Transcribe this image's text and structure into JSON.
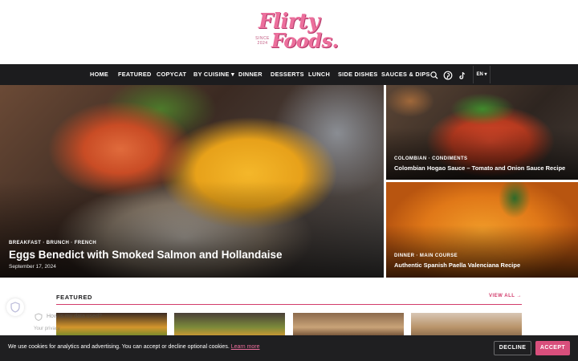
{
  "brand": {
    "logo_line1": "Flirty",
    "logo_line2": "Foods.",
    "since": "SINCE 2024",
    "accent_color": "#d23b6b"
  },
  "nav": {
    "items": [
      "HOME",
      "FEATURED",
      "COPYCAT",
      "BY CUISINE ▾",
      "DINNER",
      "DESSERTS",
      "LUNCH",
      "SIDE DISHES",
      "SAUCES & DIPS"
    ],
    "icons": [
      "search-icon",
      "pinterest-icon",
      "tiktok-icon"
    ],
    "language": "EN ▾"
  },
  "hero": {
    "main": {
      "category": "BREAKFAST · BRUNCH · FRENCH",
      "title": "Eggs Benedict with Smoked Salmon and Hollandaise",
      "date": "September 17, 2024"
    },
    "side": [
      {
        "category": "COLOMBIAN · CONDIMENTS",
        "title": "Colombian Hogao Sauce – Tomato and Onion Sauce Recipe"
      },
      {
        "category": "DINNER · MAIN COURSE",
        "title": "Authentic Spanish Paella Valenciana Recipe"
      }
    ]
  },
  "featured": {
    "heading": "FEATURED",
    "view_all": "VIEW ALL →"
  },
  "privacy_widget": {
    "title": "How is my data used?",
    "body": "Your privacy"
  },
  "cookie_bar": {
    "text": "We use cookies for analytics and advertising. You can accept or decline optional cookies.",
    "learn_more": "Learn more",
    "decline": "DECLINE",
    "accept": "ACCEPT"
  }
}
